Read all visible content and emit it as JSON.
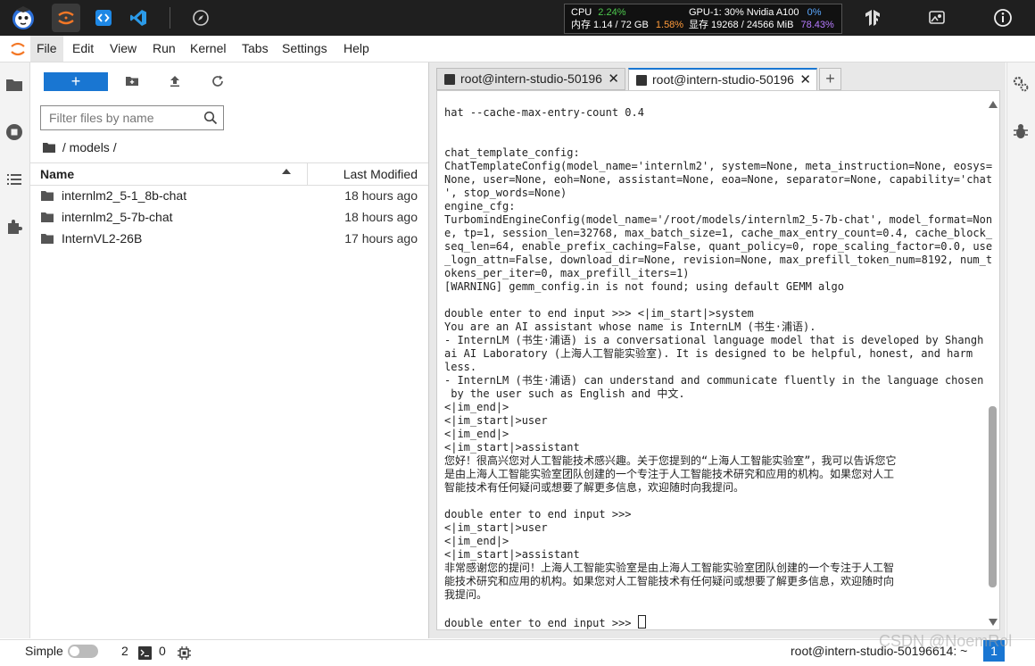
{
  "topbar": {
    "icons": [
      "mascot-icon",
      "jupyter-icon",
      "code-icon",
      "vscode-icon",
      "compass-icon"
    ],
    "stats": {
      "cpu_label": "CPU",
      "cpu_value": "2.24%",
      "mem_label": "内存 1.14 / 72 GB",
      "mem_value": "1.58%",
      "gpu_label": "GPU-1: 30% Nvidia A100",
      "gpu_value": "0%",
      "vram_label": "显存 19268 / 24566 MiB",
      "vram_value": "78.43%"
    },
    "right_icons": [
      "tensorflow-icon",
      "screen-capture-icon",
      "info-icon"
    ]
  },
  "menu": {
    "items": [
      "File",
      "Edit",
      "View",
      "Run",
      "Kernel",
      "Tabs",
      "Settings",
      "Help"
    ]
  },
  "filebrowser": {
    "new_label": "+",
    "filter_placeholder": "Filter files by name",
    "breadcrumb": "/ models /",
    "header": {
      "name": "Name",
      "modified": "Last Modified"
    },
    "files": [
      {
        "name": "internlm2_5-1_8b-chat",
        "modified": "18 hours ago"
      },
      {
        "name": "internlm2_5-7b-chat",
        "modified": "18 hours ago"
      },
      {
        "name": "InternVL2-26B",
        "modified": "17 hours ago"
      }
    ]
  },
  "tabs": [
    {
      "label": "root@intern-studio-50196",
      "close": "✕",
      "active": false
    },
    {
      "label": "root@intern-studio-50196",
      "close": "✕",
      "active": true
    }
  ],
  "add_tab": "+",
  "terminal": {
    "text": "hat --cache-max-entry-count 0.4\n\n\nchat_template_config:\nChatTemplateConfig(model_name='internlm2', system=None, meta_instruction=None, eosys=\nNone, user=None, eoh=None, assistant=None, eoa=None, separator=None, capability='chat\n', stop_words=None)\nengine_cfg:\nTurbomindEngineConfig(model_name='/root/models/internlm2_5-7b-chat', model_format=Non\ne, tp=1, session_len=32768, max_batch_size=1, cache_max_entry_count=0.4, cache_block_\nseq_len=64, enable_prefix_caching=False, quant_policy=0, rope_scaling_factor=0.0, use\n_logn_attn=False, download_dir=None, revision=None, max_prefill_token_num=8192, num_t\nokens_per_iter=0, max_prefill_iters=1)\n[WARNING] gemm_config.in is not found; using default GEMM algo\n\ndouble enter to end input >>> <|im_start|>system\nYou are an AI assistant whose name is InternLM (书生·浦语).\n- InternLM (书生·浦语) is a conversational language model that is developed by Shangh\nai AI Laboratory (上海人工智能实验室). It is designed to be helpful, honest, and harm\nless.\n- InternLM (书生·浦语) can understand and communicate fluently in the language chosen\n by the user such as English and 中文.\n<|im_end|>\n<|im_start|>user\n<|im_end|>\n<|im_start|>assistant\n您好！很高兴您对人工智能技术感兴趣。关于您提到的“上海人工智能实验室”，我可以告诉您它\n是由上海人工智能实验室团队创建的一个专注于人工智能技术研究和应用的机构。如果您对人工\n智能技术有任何疑问或想要了解更多信息，欢迎随时向我提问。\n\ndouble enter to end input >>>\n<|im_start|>user\n<|im_end|>\n<|im_start|>assistant\n非常感谢您的提问！上海人工智能实验室是由上海人工智能实验室团队创建的一个专注于人工智\n能技术研究和应用的机构。如果您对人工智能技术有任何疑问或想要了解更多信息，欢迎随时向\n我提问。\n\ndouble enter to end input >>> "
  },
  "statusbar": {
    "simple": "Simple",
    "kernels": "2",
    "terminals": "0",
    "host": "root@intern-studio-50196614: ~",
    "badge": "1"
  },
  "watermark": "CSDN @NoemRol",
  "colors": {
    "accent": "#1976d2",
    "topbar": "#1f1f1f"
  }
}
